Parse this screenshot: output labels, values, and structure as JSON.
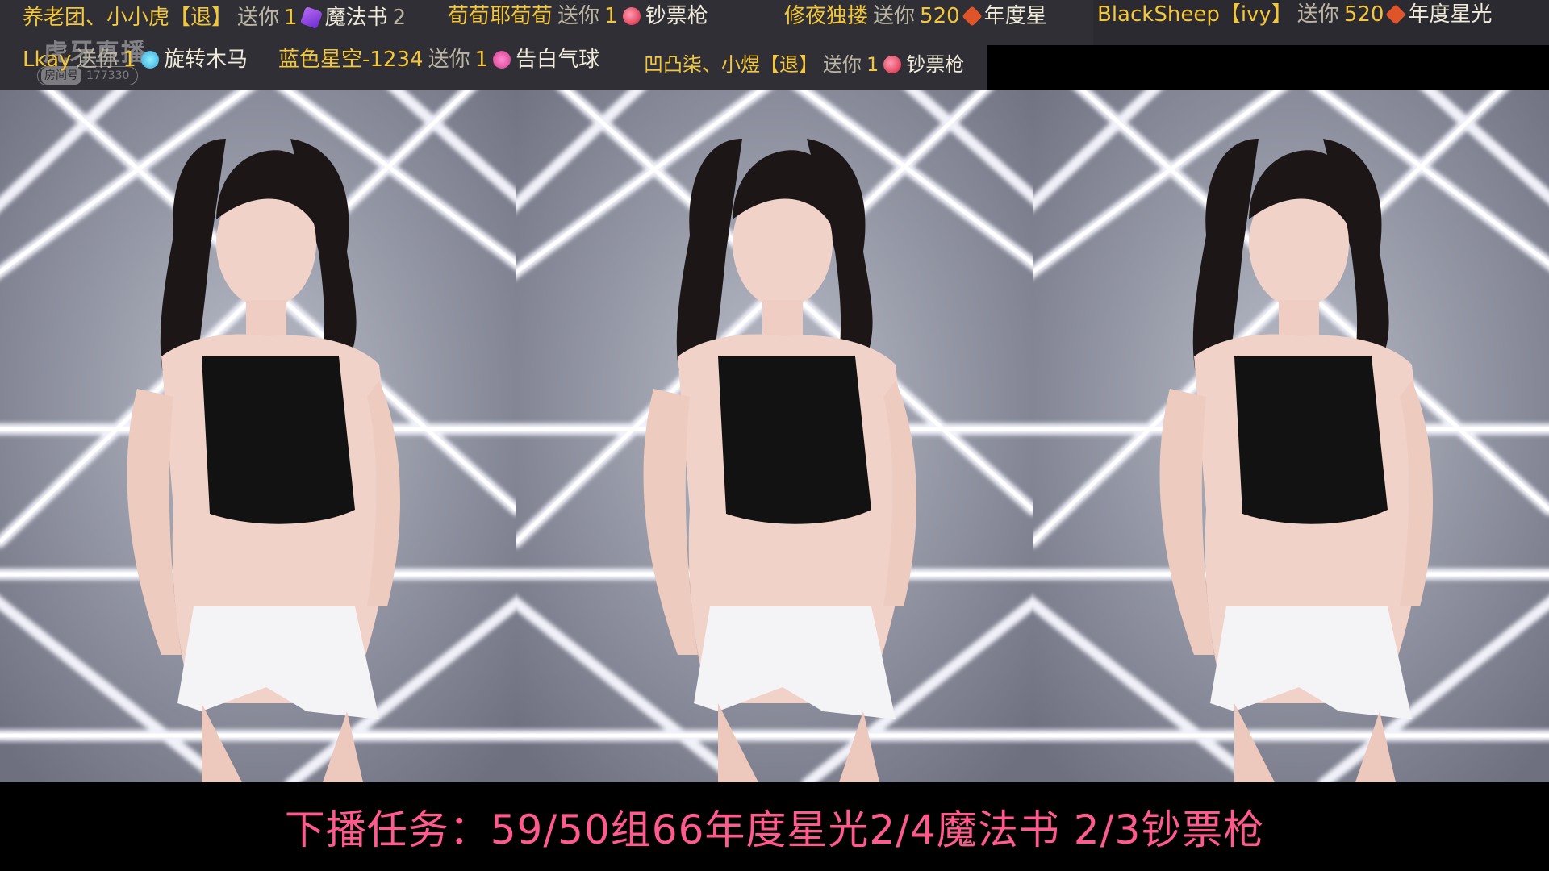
{
  "logo": {
    "brand": "虎牙直播",
    "room_label": "房间号",
    "room_number": "177330"
  },
  "gifts_row1": [
    {
      "user": "养老团、小小虎【退】",
      "sent": "送你",
      "count": "1",
      "icon": "magic-book-icon",
      "gift": "魔法书",
      "suffix": "2"
    },
    {
      "user": "荀荀耶荀荀",
      "sent": "送你",
      "count": "1",
      "icon": "money-gun-icon",
      "gift": "钞票枪"
    },
    {
      "user": "修夜独搂",
      "sent": "送你",
      "count": "520",
      "icon": "annual-star-icon",
      "gift": "年度星"
    },
    {
      "user": "BlackSheep【ivy】",
      "sent": "送你",
      "count": "520",
      "icon": "annual-star-icon",
      "gift": "年度星光"
    }
  ],
  "gifts_row2": [
    {
      "user": "Lkay",
      "sent": "送你",
      "count": "1",
      "icon": "carousel-icon",
      "gift": "旋转木马"
    },
    {
      "user": "蓝色星空-1234",
      "sent": "送你",
      "count": "1",
      "icon": "love-balloon-icon",
      "gift": "告白气球"
    },
    {
      "user": "凹凸柒、小煜【退】",
      "sent": "送你",
      "count": "1",
      "icon": "money-gun-icon",
      "gift": "钞票枪"
    }
  ],
  "colors": {
    "username": "#f3c63b",
    "caption": "#ff5a8e",
    "bar": "#2f2f35"
  },
  "caption": "下播任务：59/50组66年度星光2/4魔法书 2/3钞票枪"
}
